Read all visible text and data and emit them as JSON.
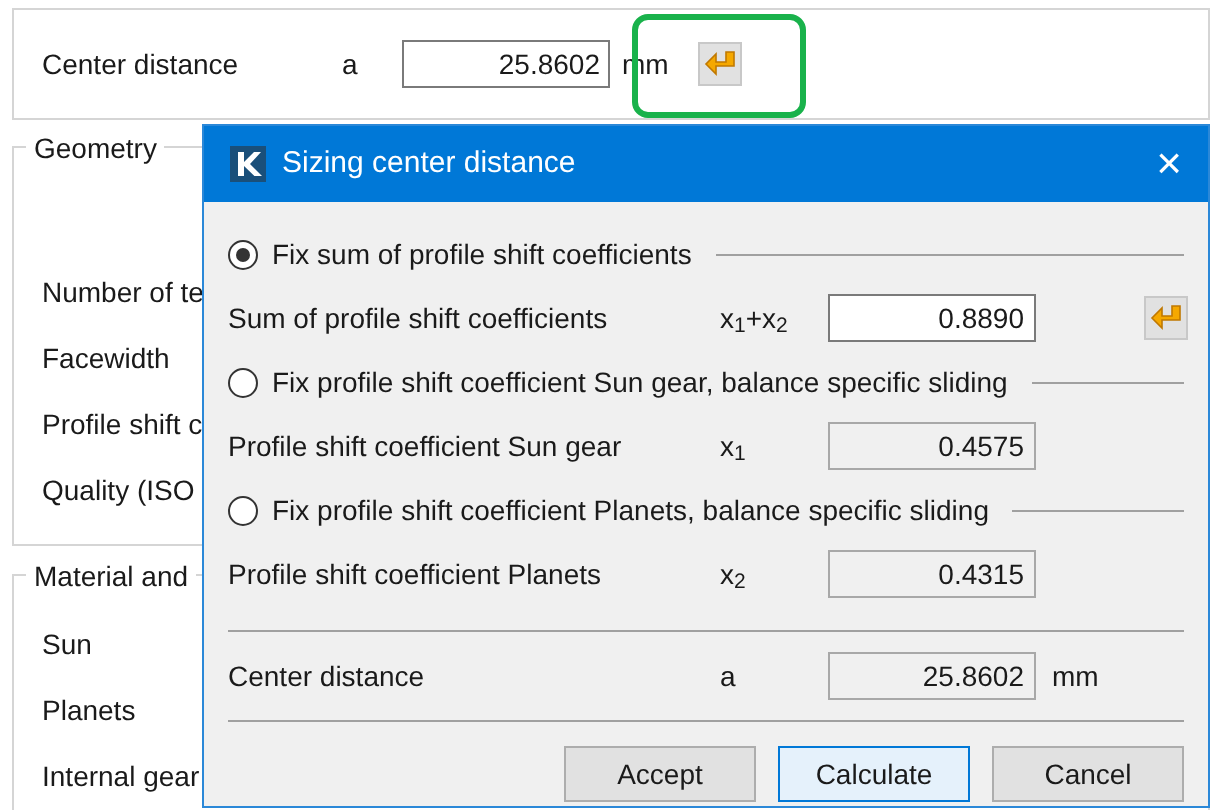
{
  "main": {
    "center_distance": {
      "label": "Center distance",
      "symbol": "a",
      "value": "25.8602",
      "unit": "mm"
    },
    "groups": [
      {
        "title": "Geometry",
        "rows": [
          "Number of te",
          "Facewidth",
          "Profile shift c",
          "Quality (ISO"
        ]
      },
      {
        "title": "Material and",
        "rows": [
          "Sun",
          "Planets",
          "Internal gear"
        ]
      }
    ]
  },
  "dialog": {
    "title": "Sizing center distance",
    "close": "×",
    "options": [
      {
        "radio": "Fix sum of profile shift coefficients",
        "selected": true,
        "label": "Sum of profile shift coefficients",
        "symbol": "x$_{1}$+x$_{2}$",
        "value": "0.8890",
        "editable": true,
        "apply_button": true
      },
      {
        "radio": "Fix profile shift coefficient Sun gear, balance specific sliding",
        "selected": false,
        "label": "Profile shift coefficient Sun gear",
        "symbol": "x$_{1}$",
        "value": "0.4575",
        "editable": false,
        "apply_button": false
      },
      {
        "radio": "Fix profile shift coefficient Planets, balance specific sliding",
        "selected": false,
        "label": "Profile shift coefficient Planets",
        "symbol": "x$_{2}$",
        "value": "0.4315",
        "editable": false,
        "apply_button": false
      }
    ],
    "result": {
      "label": "Center distance",
      "symbol": "a",
      "value": "25.8602",
      "unit": "mm"
    },
    "buttons": [
      {
        "label": "Accept",
        "focused": false
      },
      {
        "label": "Calculate",
        "focused": true
      },
      {
        "label": "Cancel",
        "focused": false
      }
    ]
  }
}
